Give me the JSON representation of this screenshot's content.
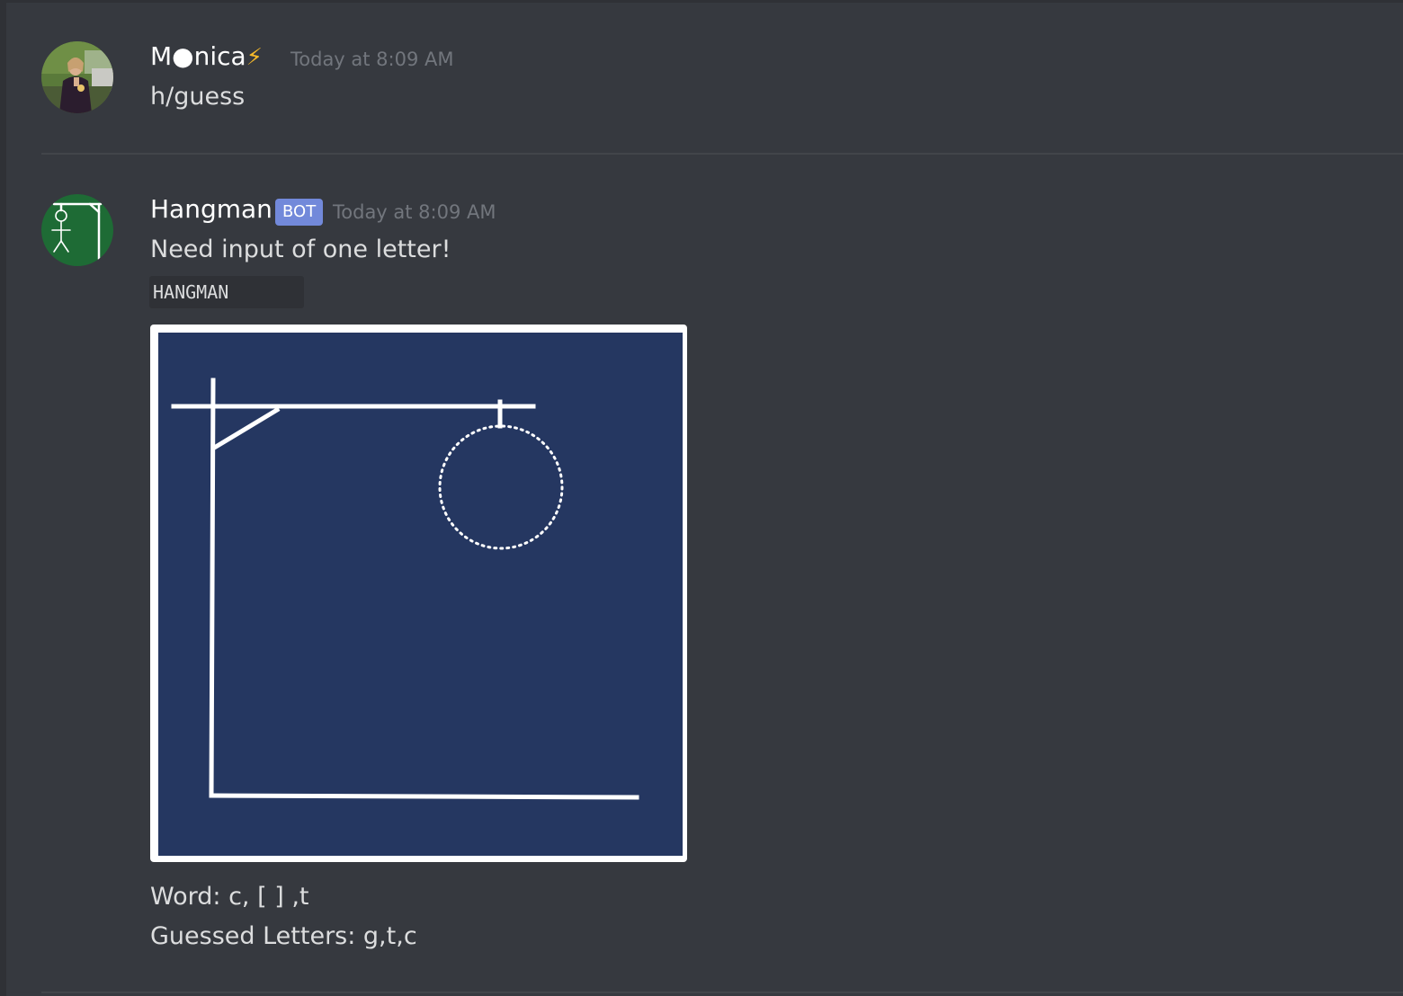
{
  "messages": [
    {
      "author": "M●nica",
      "author_decoration": "⚡",
      "timestamp": "Today at 8:09 AM",
      "content": "h/guess"
    },
    {
      "author": "Hangman",
      "bot_tag": "BOT",
      "timestamp": "Today at 8:09 AM",
      "content": "Need input of one letter!",
      "code_chip": "HANGMAN",
      "game": {
        "word_line": "Word: c, [ ] ,t",
        "guessed_line": "Guessed Letters: g,t,c"
      }
    }
  ],
  "colors": {
    "background": "#36393f",
    "board": "#253761",
    "bot_tag": "#7289da",
    "timestamp": "#72767d"
  },
  "icons": {
    "monica_avatar": "user-photo-avatar",
    "hangman_avatar": "gallows-avatar",
    "bolt": "lightning-bolt-icon"
  }
}
